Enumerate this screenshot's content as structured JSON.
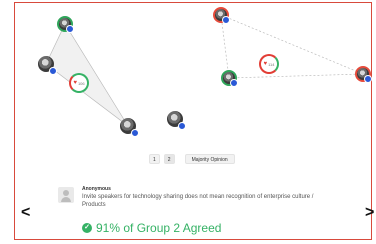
{
  "hubs": {
    "group1_label": "106",
    "group2_label": "114"
  },
  "pagination": {
    "pages": [
      "1",
      "2"
    ],
    "majority_label": "Majority Opinion"
  },
  "comment": {
    "author": "Anonymous",
    "text": "Invite speakers for technology sharing does not mean recognition of enterprise culture / Products",
    "agree_text": "91% of Group 2 Agreed"
  },
  "navigation": {
    "prev_symbol": "<",
    "next_symbol": ">"
  },
  "icons": {
    "heart": "♥",
    "check": "✓"
  },
  "colors": {
    "frame_border": "#d84a3c",
    "agree_green": "#35b265",
    "disagree_red": "#e23d35",
    "badge_blue": "#2a59d6"
  }
}
